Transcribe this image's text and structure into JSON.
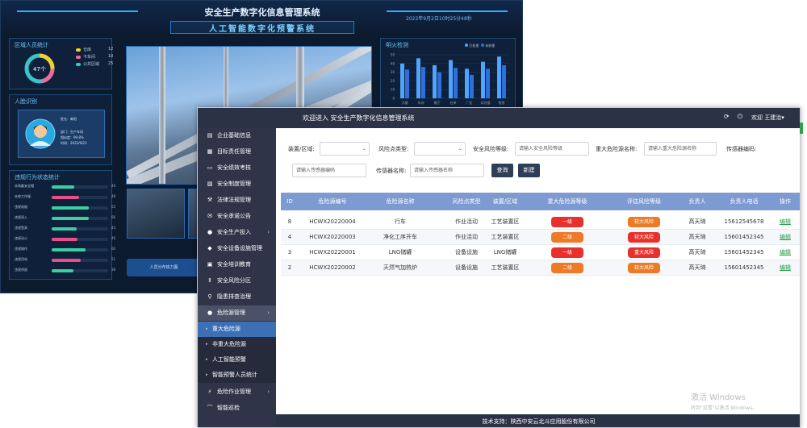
{
  "dashboard": {
    "title": "安全生产数字化信息管理系统",
    "subtitle": "人工智能数字化预警系统",
    "datetime": "2022年9月2日10时25分48秒",
    "area_panel": {
      "title": "区域人员统计",
      "center_value": "47个",
      "legend": [
        {
          "label": "仓库",
          "value": "12",
          "color": "#f2d12e"
        },
        {
          "label": "卡车间",
          "value": "10",
          "color": "#f06aa0"
        },
        {
          "label": "公共区域",
          "value": "25",
          "color": "#38c5c9"
        }
      ]
    },
    "face_panel": {
      "title": "人脸识别",
      "name_label": "姓名",
      "name_value": "邮阳",
      "dept_label": "部门",
      "dept_value": "生产车间",
      "rate_label": "相似度",
      "rate_value": "99.8%",
      "time_label": "时间",
      "time_value": "2022/9/23"
    },
    "violation_panel": {
      "title": "违规行为状态统计",
      "rows": [
        {
          "label": "未佩戴安全帽",
          "value": "40",
          "fill": 0.4,
          "color": "#3ccfa3"
        },
        {
          "label": "未穿工作服",
          "value": "48",
          "fill": 0.48,
          "color": "#e84f8a"
        },
        {
          "label": "违规吸烟",
          "value": "65",
          "fill": 0.65,
          "color": "#3ccfa3"
        },
        {
          "label": "违规闯入",
          "value": "66",
          "fill": 0.66,
          "color": "#3ccfa3"
        },
        {
          "label": "违规登高",
          "value": "44",
          "fill": 0.44,
          "color": "#3ccfa3"
        },
        {
          "label": "违规动火",
          "value": "46",
          "fill": 0.46,
          "color": "#e84f8a"
        },
        {
          "label": "违规操作",
          "value": "60",
          "fill": 0.6,
          "color": "#3ccfa3"
        },
        {
          "label": "违规用电",
          "value": "51",
          "fill": 0.51,
          "color": "#e84f8a"
        },
        {
          "label": "违规停留",
          "value": "38",
          "fill": 0.38,
          "color": "#3ccfa3"
        }
      ]
    },
    "hazard_panel": {
      "title": "明火检测",
      "legend": [
        "已处理",
        "未处理"
      ],
      "categories": [
        "大楼",
        "车间",
        "餐厅",
        "仓库",
        "厂区",
        "实验楼",
        "宿舍"
      ],
      "series_a": [
        40,
        46,
        38,
        44,
        34,
        42,
        48
      ],
      "series_b": [
        33,
        36,
        30,
        35,
        27,
        34,
        38
      ],
      "ylim": [
        0,
        50
      ],
      "colors": [
        "#4ea4ff",
        "#2f6fdc"
      ]
    },
    "bottom_button": "人员分布热力图"
  },
  "app": {
    "header": {
      "welcome": "欢迎进入  安全生产数字化信息管理系统",
      "user": "欢迎  王建治▾",
      "refresh_icon": "⟳",
      "logout_icon": "⏻"
    },
    "sidebar": {
      "items": [
        {
          "icon": "▤",
          "label": "企业基础信息",
          "chevron": ""
        },
        {
          "icon": "▦",
          "label": "目标责任管理",
          "chevron": ""
        },
        {
          "icon": "▭",
          "label": "安全绩效考核",
          "chevron": ""
        },
        {
          "icon": "▧",
          "label": "安全制度管理",
          "chevron": ""
        },
        {
          "icon": "⚒",
          "label": "法律法规管理",
          "chevron": ""
        },
        {
          "icon": "✉",
          "label": "安全承诺公告",
          "chevron": ""
        },
        {
          "icon": "●",
          "label": "安全生产投入",
          "chevron": "›"
        },
        {
          "icon": "◆",
          "label": "安全设备设施管理",
          "chevron": ""
        },
        {
          "icon": "▣",
          "label": "安全培训教育",
          "chevron": ""
        },
        {
          "icon": "⇕",
          "label": "安全风险分区",
          "chevron": ""
        },
        {
          "icon": "⚲",
          "label": "隐患排查治理",
          "chevron": ""
        },
        {
          "icon": "●",
          "label": "危险源管理",
          "chevron": "›"
        }
      ],
      "subitems": [
        {
          "label": "重大危险源",
          "active": true
        },
        {
          "label": "非重大危险源",
          "active": false
        },
        {
          "label": "人工智能预警",
          "active": false
        },
        {
          "label": "智能预警人员统计",
          "active": false
        }
      ],
      "after": [
        {
          "icon": "⚡",
          "label": "危险作业管理",
          "chevron": "›"
        },
        {
          "icon": "⌒",
          "label": "智能巡检",
          "chevron": ""
        }
      ]
    },
    "filters": {
      "area_label": "装置/区域:",
      "risk_type_label": "风险点类型:",
      "risk_level_label": "安全风险等级:",
      "risk_level_placeholder": "请输入安全风险等级",
      "major_name_label": "重大危险源名称:",
      "major_name_placeholder": "请输入重大危险源名称",
      "sensor_code_label": "传感器编码:",
      "sensor_code_placeholder": "请输入传感器编码",
      "sensor_name_label": "传感器名称:",
      "sensor_name_placeholder": "请输入传感器名称",
      "query_label": "查询",
      "create_label": "新建"
    },
    "table": {
      "headers": [
        "ID",
        "危险源编号",
        "危险源名称",
        "风险点类型",
        "装置/区域",
        "重大危险源等级",
        "评估风险等级",
        "负责人",
        "负责人电话",
        "操作"
      ],
      "rows": [
        {
          "id": "8",
          "code": "HCWX20220004",
          "name": "行车",
          "type": "作业活动",
          "area": "工艺装置区",
          "level": "一级",
          "level_color": "#e8312c",
          "risk": "较大风险",
          "risk_color": "#ee7a25",
          "owner": "高天琦",
          "phone": "15612545678",
          "op": "编辑"
        },
        {
          "id": "4",
          "code": "HCWX20220003",
          "name": "净化工序开车",
          "type": "作业活动",
          "area": "工艺装置区",
          "level": "二级",
          "level_color": "#ee7a25",
          "risk": "较大风险",
          "risk_color": "#e8312c",
          "owner": "高天琦",
          "phone": "15601452345",
          "op": "编辑"
        },
        {
          "id": "3",
          "code": "HCWX20220001",
          "name": "LNG储罐",
          "type": "设备设施",
          "area": "LNG储罐",
          "level": "一级",
          "level_color": "#e8312c",
          "risk": "重大风险",
          "risk_color": "#e8312c",
          "owner": "高天琦",
          "phone": "15601452345",
          "op": "编辑"
        },
        {
          "id": "2",
          "code": "HCWX20220002",
          "name": "天然气加热炉",
          "type": "设备设施",
          "area": "工艺装置区",
          "level": "二级",
          "level_color": "#ee7a25",
          "risk": "较大风险",
          "risk_color": "#ee7a25",
          "owner": "高天琦",
          "phone": "15601452345",
          "op": "编辑"
        }
      ]
    },
    "footer": "技术支持：陕西中安云北斗应用股份有限公司"
  },
  "watermark": {
    "line1": "激活 Windows",
    "line2": "转到\"设置\"以激活 Windows。"
  }
}
